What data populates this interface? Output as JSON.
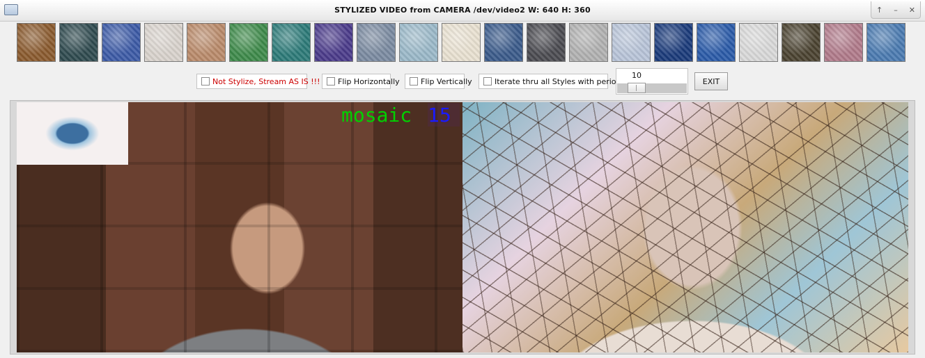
{
  "window": {
    "title": "STYLIZED VIDEO from CAMERA /dev/video2  W: 640  H: 360",
    "controls": [
      "↑",
      "–",
      "✕"
    ]
  },
  "styles": [
    {
      "name": "style-1",
      "color": "#8a5a2e"
    },
    {
      "name": "style-2",
      "color": "#2f4a4f"
    },
    {
      "name": "style-3",
      "color": "#3c5aa6"
    },
    {
      "name": "style-4",
      "color": "#d8d2cc"
    },
    {
      "name": "style-5",
      "color": "#b98a6a"
    },
    {
      "name": "style-6",
      "color": "#3e8a4a"
    },
    {
      "name": "style-7",
      "color": "#2c7a78"
    },
    {
      "name": "style-8",
      "color": "#4a3a8a"
    },
    {
      "name": "style-9",
      "color": "#7a8aa0"
    },
    {
      "name": "style-10",
      "color": "#9ab8c8"
    },
    {
      "name": "style-11",
      "color": "#e8e0d0"
    },
    {
      "name": "style-12",
      "color": "#3a5a8a"
    },
    {
      "name": "style-13",
      "color": "#4a4a50"
    },
    {
      "name": "style-14",
      "color": "#b0b0b0"
    },
    {
      "name": "style-15",
      "color": "#b8c4d8"
    },
    {
      "name": "style-16",
      "color": "#1a3a7a"
    },
    {
      "name": "style-17",
      "color": "#2a5aa8"
    },
    {
      "name": "style-18",
      "color": "#d8d8d8"
    },
    {
      "name": "style-19",
      "color": "#4a4230"
    },
    {
      "name": "style-20",
      "color": "#b07a8a"
    },
    {
      "name": "style-21",
      "color": "#4a7ab0"
    }
  ],
  "controls": {
    "not_stylize": "Not Stylize, Stream AS IS !!!",
    "flip_h": "Flip Horizontally",
    "flip_v": "Flip Vertically",
    "iterate": "Iterate thru all Styles with period:",
    "period_value": "10",
    "period_level": 0.2,
    "exit": "EXIT"
  },
  "video": {
    "style_name": "mosaic",
    "style_index": "15"
  }
}
